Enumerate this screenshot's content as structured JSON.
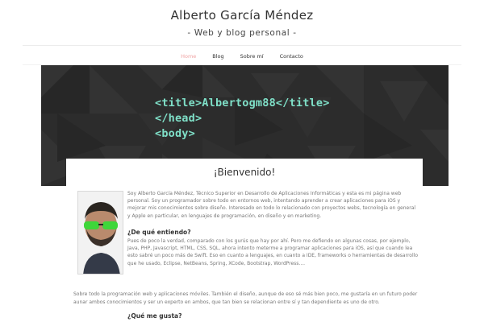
{
  "header": {
    "title": "Alberto García Méndez",
    "tagline": "- Web y blog personal -"
  },
  "nav": {
    "items": [
      {
        "label": "Home",
        "active": true
      },
      {
        "label": "Blog",
        "active": false
      },
      {
        "label": "Sobre mí",
        "active": false
      },
      {
        "label": "Contacto",
        "active": false
      }
    ]
  },
  "hero": {
    "code_lines": [
      "<title>Albertogm88</title>",
      "</head>",
      "<body>"
    ],
    "text_color": "#7fe0c8",
    "background": "#2d2d2d"
  },
  "content": {
    "welcome": "¡Bienvenido!",
    "photo_alt": "profile-photo",
    "intro": "Soy Alberto García Méndez, Técnico Superior en Desarrollo de Aplicaciones Informáticas y esta es mi página web personal. Soy un programador sobre todo en entornos web, intentando aprender a crear aplicaciones para iOS y mejorar mis conocimientos sobre diseño. Interesado en todo lo relacionado con proyectos webs, tecnología en general y Apple en particular, en lenguajes de programación, en diseño y en marketing.",
    "heading_1": "¿De qué entiendo?",
    "para_1": "Pues de poco la verdad, comparado con los gurús que hay por ahí. Pero me defiendo en algunas cosas, por ejemplo, Java, PHP, Javascript, HTML, CSS, SQL, ahora intento meterme a programar aplicaciones para iOS, así que cuando lea esto sabré un poco más de Swift. Eso en cuanto a lenguajes, en cuanto a IDE, frameworks o herramientas de desarrollo que he usado, Eclipse, NetBeans, Spring, XCode, Bootstrap, WordPress....",
    "heading_2": "¿Qué me gusta?",
    "para_2": "Sobre todo la programación web y aplicaciones móviles. También el diseño, aunque de eso sé más bien poco, me gustaría en un futuro poder aunar ambos conocimientos y ser un experto en ambos, que tan bien se relacionan entre sí y tan dependiente es uno de otro."
  }
}
